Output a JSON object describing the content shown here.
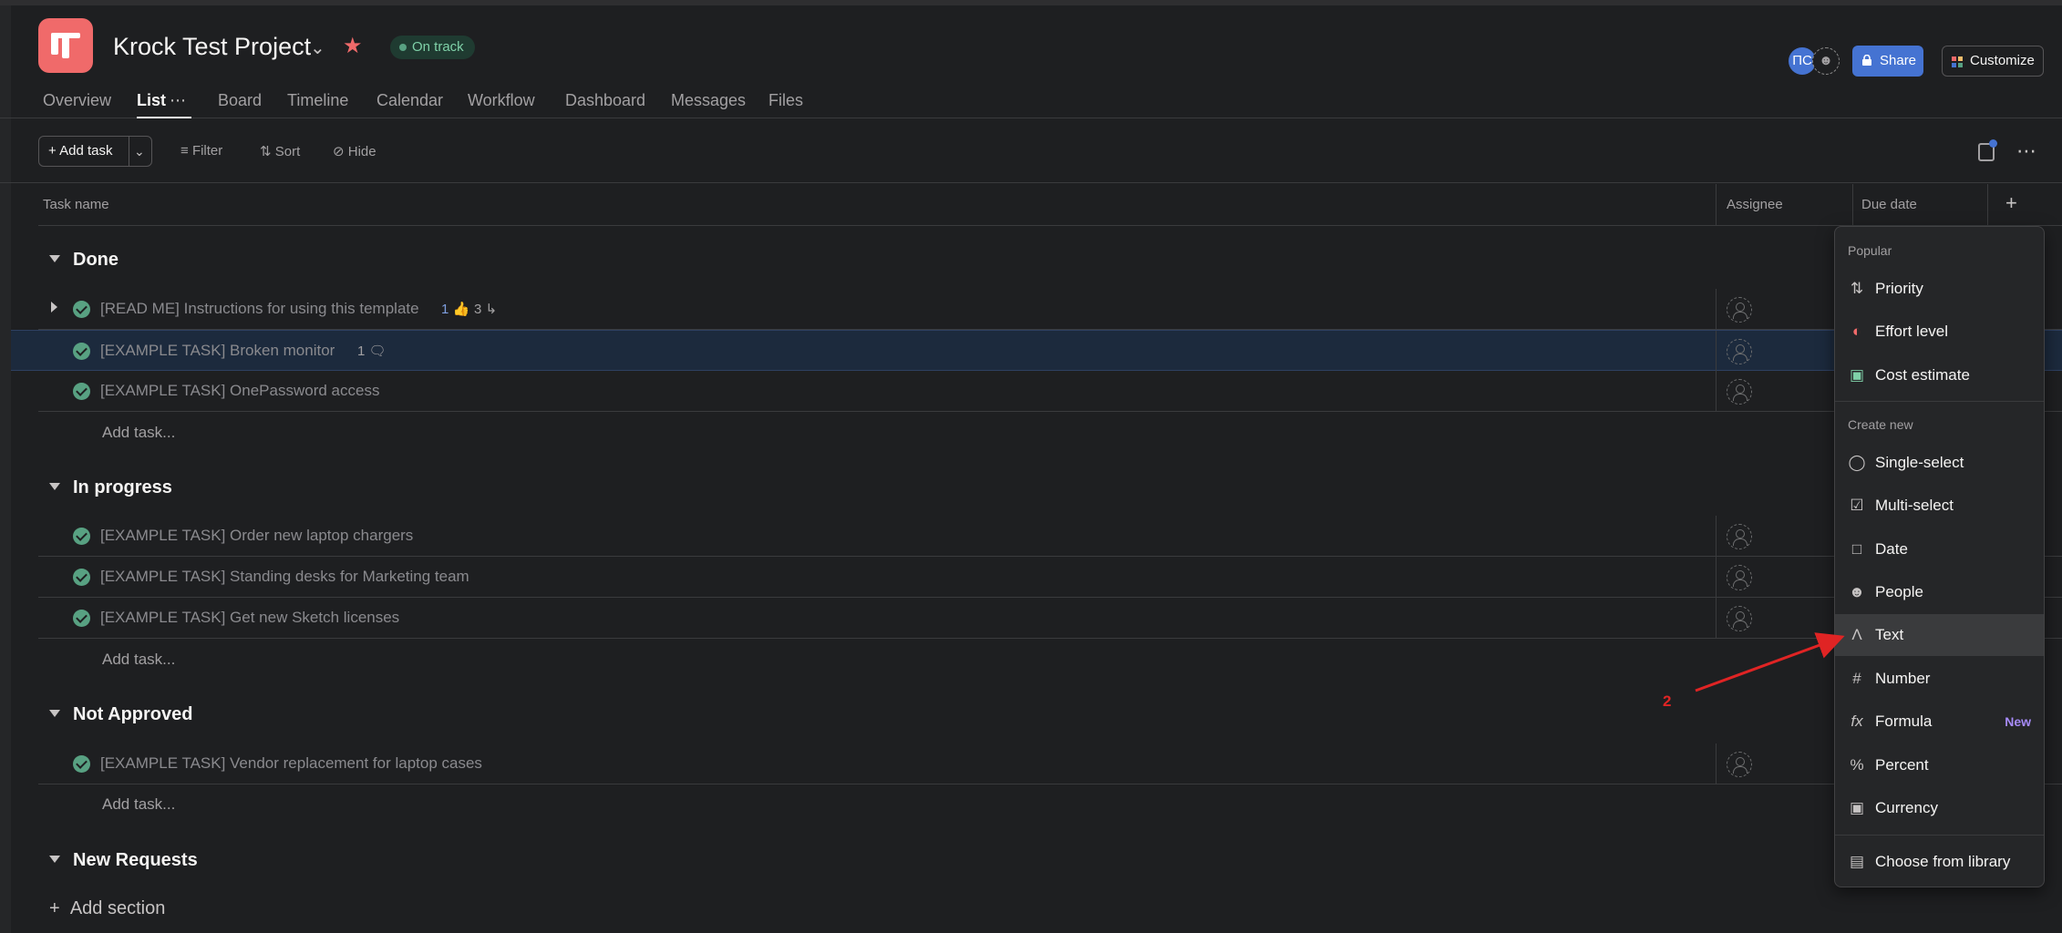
{
  "header": {
    "project_title": "Krock Test Project",
    "status": "On track",
    "avatar_initials": "ПС",
    "share_label": "Share",
    "customize_label": "Customize"
  },
  "tabs": [
    {
      "label": "Overview"
    },
    {
      "label": "List",
      "active": true
    },
    {
      "label": "Board"
    },
    {
      "label": "Timeline"
    },
    {
      "label": "Calendar"
    },
    {
      "label": "Workflow"
    },
    {
      "label": "Dashboard"
    },
    {
      "label": "Messages"
    },
    {
      "label": "Files"
    }
  ],
  "toolbar": {
    "add_task_label": "Add task",
    "filter_label": "Filter",
    "sort_label": "Sort",
    "hide_label": "Hide"
  },
  "columns": {
    "task_name": "Task name",
    "assignee": "Assignee",
    "due_date": "Due date"
  },
  "sections": [
    {
      "name": "Done",
      "tasks": [
        {
          "name": "[READ ME] Instructions for using this template",
          "likes": "1",
          "subtasks": "3"
        },
        {
          "name": "[EXAMPLE TASK] Broken monitor",
          "comments": "1"
        },
        {
          "name": "[EXAMPLE TASK] OnePassword access"
        }
      ],
      "add_task": "Add task..."
    },
    {
      "name": "In progress",
      "tasks": [
        {
          "name": "[EXAMPLE TASK] Order new laptop chargers"
        },
        {
          "name": "[EXAMPLE TASK] Standing desks for Marketing team"
        },
        {
          "name": "[EXAMPLE TASK] Get new Sketch licenses"
        }
      ],
      "add_task": "Add task..."
    },
    {
      "name": "Not Approved",
      "tasks": [
        {
          "name": "[EXAMPLE TASK] Vendor replacement for laptop cases"
        }
      ],
      "add_task": "Add task..."
    },
    {
      "name": "New Requests",
      "tasks": []
    }
  ],
  "add_section_label": "Add section",
  "field_menu": {
    "popular_heading": "Popular",
    "popular": [
      {
        "label": "Priority",
        "icon": "priority-icon"
      },
      {
        "label": "Effort level",
        "icon": "gauge-icon"
      },
      {
        "label": "Cost estimate",
        "icon": "money-icon"
      }
    ],
    "create_heading": "Create new",
    "create": [
      {
        "label": "Single-select",
        "icon": "single-select-icon"
      },
      {
        "label": "Multi-select",
        "icon": "multi-select-icon"
      },
      {
        "label": "Date",
        "icon": "calendar-icon"
      },
      {
        "label": "People",
        "icon": "person-icon"
      },
      {
        "label": "Text",
        "icon": "text-icon",
        "hovered": true
      },
      {
        "label": "Number",
        "icon": "hash-icon"
      },
      {
        "label": "Formula",
        "icon": "formula-icon",
        "badge": "New"
      },
      {
        "label": "Percent",
        "icon": "percent-icon"
      },
      {
        "label": "Currency",
        "icon": "currency-icon"
      }
    ],
    "library_label": "Choose from library"
  },
  "annotation": {
    "number": "2",
    "color": "#e02424"
  },
  "colors": {
    "brand": "#f06a6a",
    "accent": "#4573d2",
    "complete": "#58a182"
  }
}
